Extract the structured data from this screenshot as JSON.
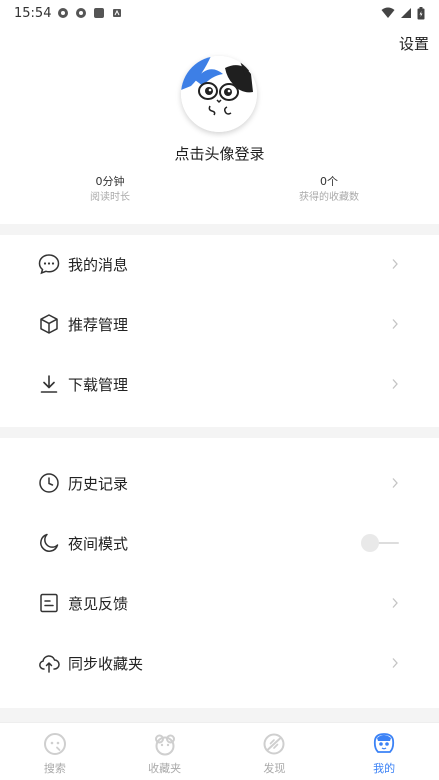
{
  "status_bar": {
    "time": "15:54"
  },
  "header": {
    "settings_label": "设置"
  },
  "profile": {
    "login_text": "点击头像登录"
  },
  "stats": [
    {
      "value": "0分钟",
      "label": "阅读时长"
    },
    {
      "value": "0个",
      "label": "获得的收藏数"
    }
  ],
  "menu_group_1": [
    {
      "label": "我的消息",
      "icon": "chat-bubble-icon"
    },
    {
      "label": "推荐管理",
      "icon": "cube-icon"
    },
    {
      "label": "下载管理",
      "icon": "download-icon"
    }
  ],
  "menu_group_2": [
    {
      "label": "历史记录",
      "icon": "clock-icon"
    },
    {
      "label": "夜间模式",
      "icon": "moon-icon",
      "toggle_on": false
    },
    {
      "label": "意见反馈",
      "icon": "feedback-icon"
    },
    {
      "label": "同步收藏夹",
      "icon": "cloud-sync-icon"
    }
  ],
  "tabbar": {
    "items": [
      {
        "label": "搜索",
        "icon": "search-icon",
        "active": false
      },
      {
        "label": "收藏夹",
        "icon": "favorites-icon",
        "active": false
      },
      {
        "label": "发现",
        "icon": "discover-icon",
        "active": false
      },
      {
        "label": "我的",
        "icon": "profile-icon",
        "active": true
      }
    ]
  },
  "colors": {
    "accent": "#3b82f6",
    "muted": "#aaaaaa",
    "divider_bg": "#f4f4f4"
  }
}
